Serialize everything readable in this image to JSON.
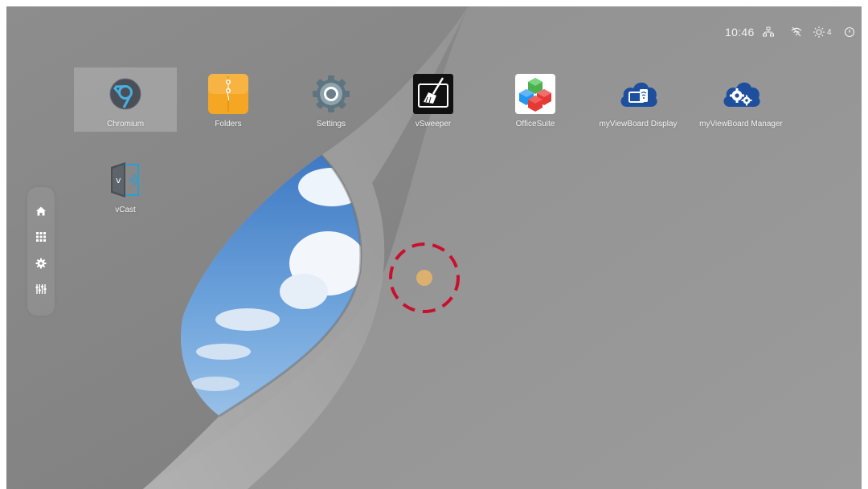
{
  "status_bar": {
    "time": "10:46",
    "brightness_level": "4",
    "icons": [
      "ethernet-icon",
      "wifi-off-icon",
      "brightness-icon",
      "power-icon"
    ]
  },
  "apps": [
    {
      "label": "Chromium",
      "icon": "chromium-icon",
      "selected": true
    },
    {
      "label": "Folders",
      "icon": "folders-icon"
    },
    {
      "label": "Settings",
      "icon": "settings-gear-icon"
    },
    {
      "label": "vSweeper",
      "icon": "vsweeper-broom-icon"
    },
    {
      "label": "OfficeSuite",
      "icon": "officesuite-cubes-icon"
    },
    {
      "label": "myViewBoard Display",
      "icon": "myviewboard-display-cloud-icon"
    },
    {
      "label": "myViewBoard Manager",
      "icon": "myviewboard-manager-cloud-icon"
    },
    {
      "label": "vCast",
      "icon": "vcast-door-icon"
    }
  ],
  "sidebar": {
    "items": [
      "home-icon",
      "apps-grid-icon",
      "settings-icon",
      "equalizer-icon"
    ]
  },
  "colors": {
    "wallpaper_gray": "#8f8f8f",
    "touch_ring": "#c8102e",
    "touch_dot": "#dcb06e",
    "folders_orange": "#f5a623",
    "cloud_blue": "#1e4f9e"
  }
}
